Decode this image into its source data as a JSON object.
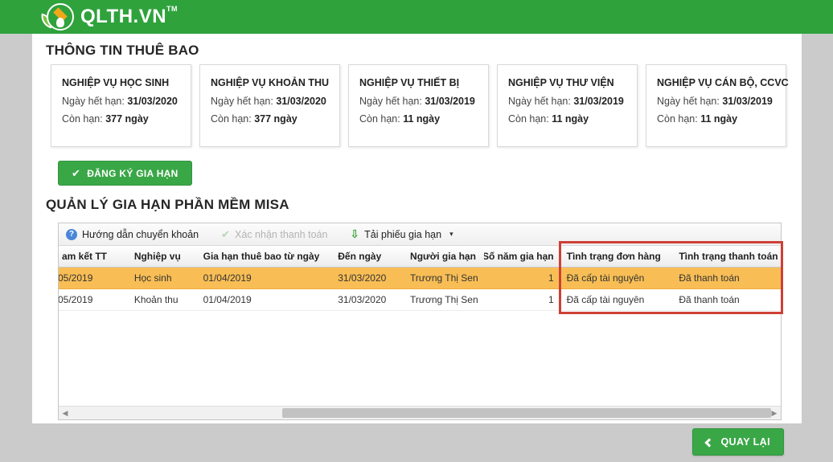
{
  "header": {
    "brand": "QLTH.VN",
    "brand_tm": "TM"
  },
  "subscription": {
    "title": "THÔNG TIN THUÊ BAO",
    "expiry_label": "Ngày hết hạn:",
    "remaining_label": "Còn hạn:",
    "cards": [
      {
        "name": "NGHIỆP VỤ HỌC SINH",
        "expiry": "31/03/2020",
        "remaining": "377 ngày"
      },
      {
        "name": "NGHIỆP VỤ KHOẢN THU",
        "expiry": "31/03/2020",
        "remaining": "377 ngày"
      },
      {
        "name": "NGHIỆP VỤ THIẾT BỊ",
        "expiry": "31/03/2019",
        "remaining": "11 ngày"
      },
      {
        "name": "NGHIỆP VỤ THƯ VIỆN",
        "expiry": "31/03/2019",
        "remaining": "11 ngày"
      },
      {
        "name": "NGHIỆP VỤ CÁN BỘ, CCVC",
        "expiry": "31/03/2019",
        "remaining": "11 ngày"
      }
    ],
    "register_button": "ĐĂNG KÝ GIA HẠN"
  },
  "renewal": {
    "title": "QUẢN LÝ GIA HẠN PHẦN MỀM MISA",
    "toolbar": {
      "guide": "Hướng dẫn chuyển khoản",
      "confirm": "Xác nhận thanh toán",
      "download": "Tải phiếu gia hạn"
    },
    "table": {
      "columns": [
        "am kết TT",
        "Nghiệp vụ",
        "Gia hạn thuê bao từ ngày",
        "Đến ngày",
        "Người gia hạn",
        "Số năm gia hạn",
        "Tình trạng đơn hàng",
        "Tình trạng thanh toán"
      ],
      "rows": [
        {
          "cells": [
            "05/2019",
            "Học sinh",
            "01/04/2019",
            "31/03/2020",
            "Trương Thị Sen",
            "1",
            "Đã cấp tài nguyên",
            "Đã thanh toán"
          ],
          "selected": true
        },
        {
          "cells": [
            "05/2019",
            "Khoản thu",
            "01/04/2019",
            "31/03/2020",
            "Trương Thị Sen",
            "1",
            "Đã cấp tài nguyên",
            "Đã thanh toán"
          ],
          "selected": false
        }
      ]
    }
  },
  "footer": {
    "back_button": "QUAY LẠI"
  },
  "colors": {
    "header_green": "#2fa23c",
    "button_green": "#3aa747",
    "selected_row_orange": "#f8be55",
    "annotation_red": "#ce4035",
    "help_icon_blue": "#4a86d8"
  }
}
